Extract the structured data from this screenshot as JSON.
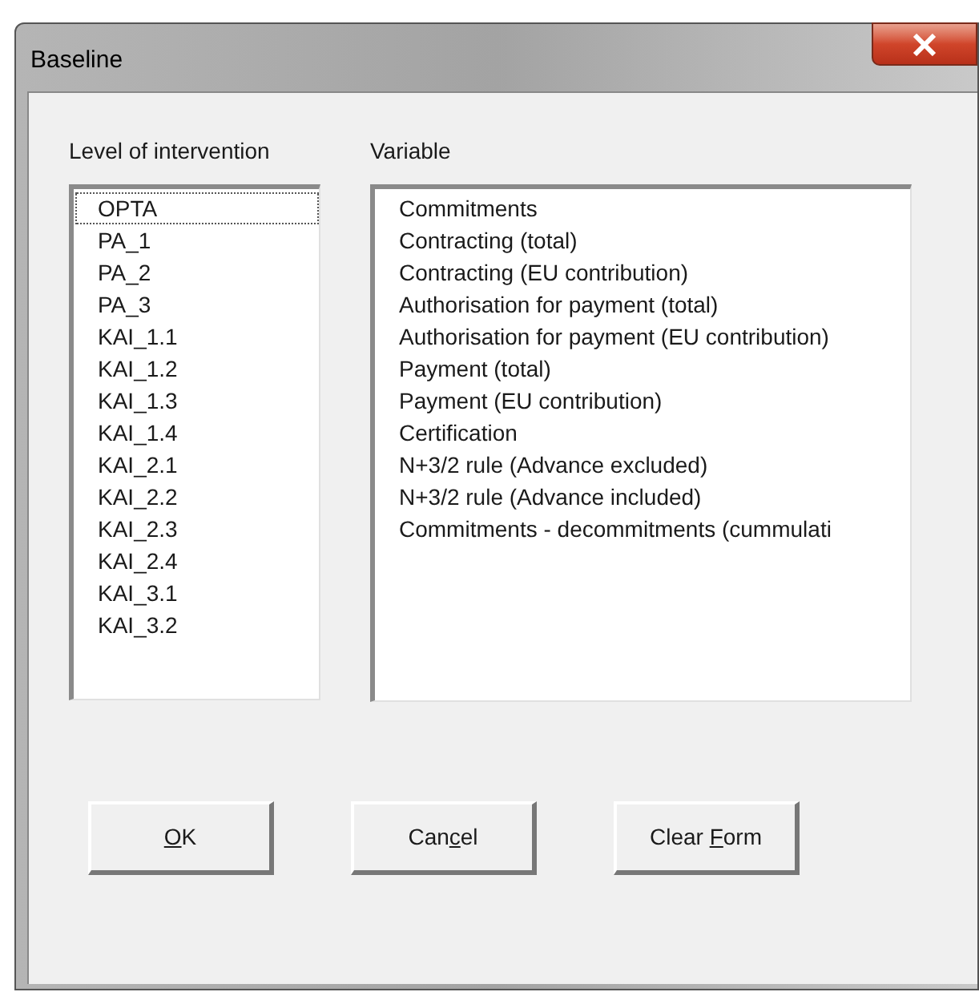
{
  "window": {
    "title": "Baseline"
  },
  "level_list": {
    "label": "Level of intervention",
    "items": [
      {
        "text": "OPTA",
        "focused": true
      },
      {
        "text": "PA_1",
        "focused": false
      },
      {
        "text": "PA_2",
        "focused": false
      },
      {
        "text": "PA_3",
        "focused": false
      },
      {
        "text": "KAI_1.1",
        "focused": false
      },
      {
        "text": "KAI_1.2",
        "focused": false
      },
      {
        "text": "KAI_1.3",
        "focused": false
      },
      {
        "text": "KAI_1.4",
        "focused": false
      },
      {
        "text": "KAI_2.1",
        "focused": false
      },
      {
        "text": "KAI_2.2",
        "focused": false
      },
      {
        "text": "KAI_2.3",
        "focused": false
      },
      {
        "text": "KAI_2.4",
        "focused": false
      },
      {
        "text": "KAI_3.1",
        "focused": false
      },
      {
        "text": "KAI_3.2",
        "focused": false
      }
    ]
  },
  "variable_list": {
    "label": "Variable",
    "items": [
      {
        "text": "Commitments",
        "focused": false
      },
      {
        "text": "Contracting (total)",
        "focused": false
      },
      {
        "text": "Contracting (EU contribution)",
        "focused": false
      },
      {
        "text": "Authorisation for payment (total)",
        "focused": false
      },
      {
        "text": "Authorisation for payment (EU contribution)",
        "focused": false
      },
      {
        "text": "Payment (total)",
        "focused": false
      },
      {
        "text": "Payment (EU contribution)",
        "focused": false
      },
      {
        "text": "Certification",
        "focused": false
      },
      {
        "text": "N+3/2 rule (Advance excluded)",
        "focused": false
      },
      {
        "text": "N+3/2 rule (Advance included)",
        "focused": false
      },
      {
        "text": "Commitments - decommitments (cummulati",
        "focused": false
      }
    ]
  },
  "buttons": [
    {
      "key": "O",
      "post": "K"
    },
    {
      "pre": "Can",
      "key": "c",
      "post": "el"
    },
    {
      "pre": "Clear ",
      "key": "F",
      "post": "orm"
    }
  ]
}
